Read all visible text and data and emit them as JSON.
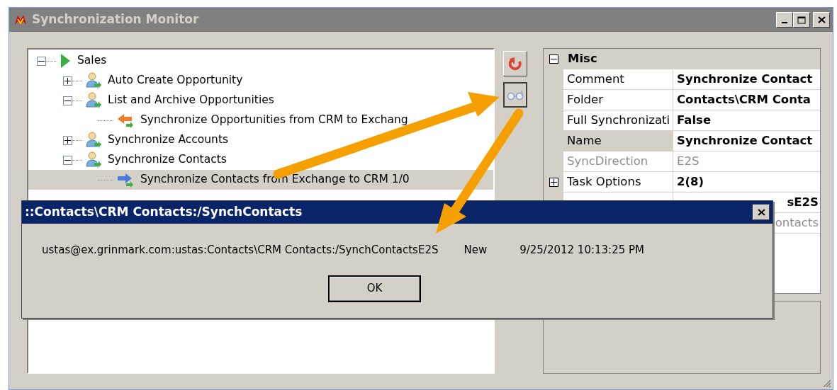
{
  "window": {
    "title": "Synchronization Monitor"
  },
  "tree": [
    {
      "label": "Sales",
      "kind": "root",
      "expanded": true,
      "selected": false,
      "children": [
        {
          "label": "Auto Create Opportunity",
          "kind": "task",
          "expanded": false,
          "selected": false
        },
        {
          "label": "List and Archive Opportunities",
          "kind": "task",
          "expanded": true,
          "selected": false,
          "children": [
            {
              "label": "Synchronize Opportunities from CRM to Exchang",
              "kind": "sync-left",
              "selected": false
            }
          ]
        },
        {
          "label": "Synchronize Accounts",
          "kind": "task",
          "expanded": false,
          "selected": false
        },
        {
          "label": "Synchronize Contacts",
          "kind": "task",
          "expanded": true,
          "selected": false,
          "children": [
            {
              "label": "Synchronize Contacts from Exchange to CRM 1/0",
              "kind": "sync-right",
              "selected": true
            }
          ]
        }
      ]
    }
  ],
  "properties": {
    "category": "Misc",
    "expanded": true,
    "rows": [
      {
        "label": "Comment",
        "value": "Synchronize Contact",
        "disabled": false,
        "selected": false
      },
      {
        "label": "Folder",
        "value": "Contacts\\CRM Conta",
        "disabled": false,
        "selected": false
      },
      {
        "label": "Full Synchronizati",
        "value": "False",
        "disabled": false,
        "selected": false
      },
      {
        "label": "Name",
        "value": "Synchronize Contact",
        "disabled": false,
        "selected": true
      },
      {
        "label": "SyncDirection",
        "value": "E2S",
        "disabled": true,
        "selected": false
      },
      {
        "label": "Task Options",
        "value": "2(8)",
        "disabled": false,
        "selected": false,
        "expandable": true
      },
      {
        "value": "sE2S",
        "disabled": false,
        "selected": false
      },
      {
        "value": "ontacts",
        "disabled": true,
        "selected": false
      }
    ]
  },
  "dialog": {
    "title": "::Contacts\\CRM Contacts:/SynchContacts",
    "address": "ustas@ex.grinmark.com:ustas:Contacts\\CRM Contacts:/SynchContactsE2S",
    "status": "New",
    "time": "9/25/2012 10:13:25 PM",
    "button": "OK"
  }
}
